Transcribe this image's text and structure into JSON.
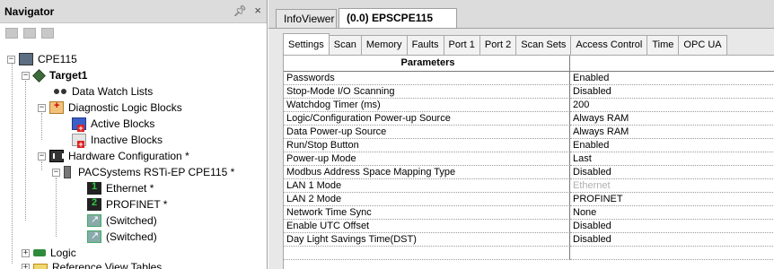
{
  "navigator": {
    "title": "Navigator",
    "pin": "↕",
    "close": "×",
    "tree": {
      "root": "CPE115",
      "target": "Target1",
      "data_watch": "Data Watch Lists",
      "diag_logic": "Diagnostic Logic Blocks",
      "active_blocks": "Active Blocks",
      "inactive_blocks": "Inactive Blocks",
      "hw_config": "Hardware Configuration *",
      "rack": "PACSystems RSTi-EP CPE115 *",
      "ethernet": "Ethernet *",
      "profinet": "PROFINET *",
      "switched1": "(Switched)",
      "switched2": "(Switched)",
      "logic": "Logic",
      "ref_tables": "Reference View Tables"
    }
  },
  "doc_tabs": {
    "infoviewer": "InfoViewer",
    "epscpe": "(0.0) EPSCPE115"
  },
  "sub_tabs": [
    "Settings",
    "Scan",
    "Memory",
    "Faults",
    "Port 1",
    "Port 2",
    "Scan Sets",
    "Access Control",
    "Time",
    "OPC UA"
  ],
  "grid": {
    "header": "Parameters",
    "rows": [
      {
        "p": "Passwords",
        "v": "Enabled"
      },
      {
        "p": "Stop-Mode I/O Scanning",
        "v": "Disabled"
      },
      {
        "p": "Watchdog Timer (ms)",
        "v": "200"
      },
      {
        "p": "Logic/Configuration Power-up Source",
        "v": "Always RAM"
      },
      {
        "p": "Data Power-up Source",
        "v": "Always RAM"
      },
      {
        "p": "Run/Stop Button",
        "v": "Enabled"
      },
      {
        "p": "Power-up Mode",
        "v": "Last"
      },
      {
        "p": "Modbus Address Space Mapping Type",
        "v": "Disabled"
      },
      {
        "p": "LAN 1 Mode",
        "v": "Ethernet"
      },
      {
        "p": "LAN 2 Mode",
        "v": "PROFINET"
      },
      {
        "p": "Network Time Sync",
        "v": "None"
      },
      {
        "p": "Enable UTC Offset",
        "v": "Disabled"
      },
      {
        "p": "Day Light Savings Time(DST)",
        "v": "Disabled"
      }
    ]
  }
}
